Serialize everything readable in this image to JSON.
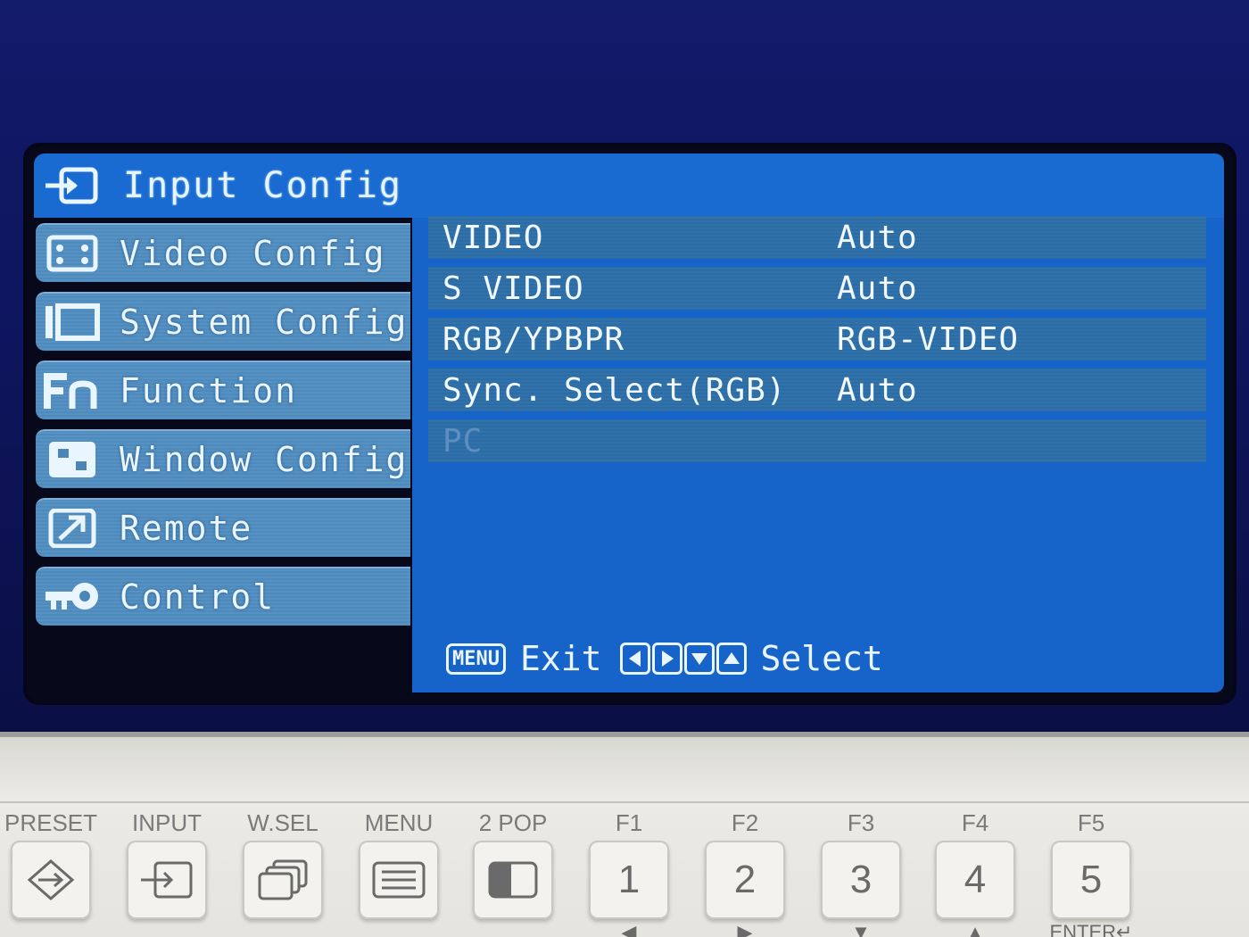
{
  "osd": {
    "title": "Input Config",
    "menu": [
      {
        "label": "Video Config",
        "icon": "video-config-icon"
      },
      {
        "label": "System Config",
        "icon": "system-config-icon"
      },
      {
        "label": "Function",
        "icon": "fn-icon"
      },
      {
        "label": "Window Config",
        "icon": "window-config-icon"
      },
      {
        "label": "Remote",
        "icon": "remote-icon"
      },
      {
        "label": "Control",
        "icon": "key-icon"
      }
    ],
    "settings": [
      {
        "name": "VIDEO",
        "value": "Auto"
      },
      {
        "name": "S VIDEO",
        "value": "Auto"
      },
      {
        "name": "RGB/YPBPR",
        "value": "RGB-VIDEO"
      },
      {
        "name": "Sync. Select(RGB)",
        "value": "Auto"
      },
      {
        "name": "PC",
        "value": ""
      }
    ],
    "footer": {
      "menu_key": "MENU",
      "exit_label": "Exit",
      "select_label": "Select"
    }
  },
  "hardware_buttons": [
    {
      "label": "PRESET",
      "face": "",
      "sub": ""
    },
    {
      "label": "INPUT",
      "face": "",
      "sub": ""
    },
    {
      "label": "W.SEL",
      "face": "",
      "sub": ""
    },
    {
      "label": "MENU",
      "face": "",
      "sub": ""
    },
    {
      "label": "2 POP",
      "face": "",
      "sub": ""
    },
    {
      "label": "F1",
      "face": "1",
      "sub": "◀"
    },
    {
      "label": "F2",
      "face": "2",
      "sub": "▶"
    },
    {
      "label": "F3",
      "face": "3",
      "sub": "▼"
    },
    {
      "label": "F4",
      "face": "4",
      "sub": "▲"
    },
    {
      "label": "F5",
      "face": "5",
      "sub": "ENTER↵"
    }
  ],
  "colors": {
    "osd_panel": "#1663c9",
    "menu_item": "#4a86b8",
    "setting_row": "#2a6aa3",
    "text": "#eaf6ff"
  }
}
